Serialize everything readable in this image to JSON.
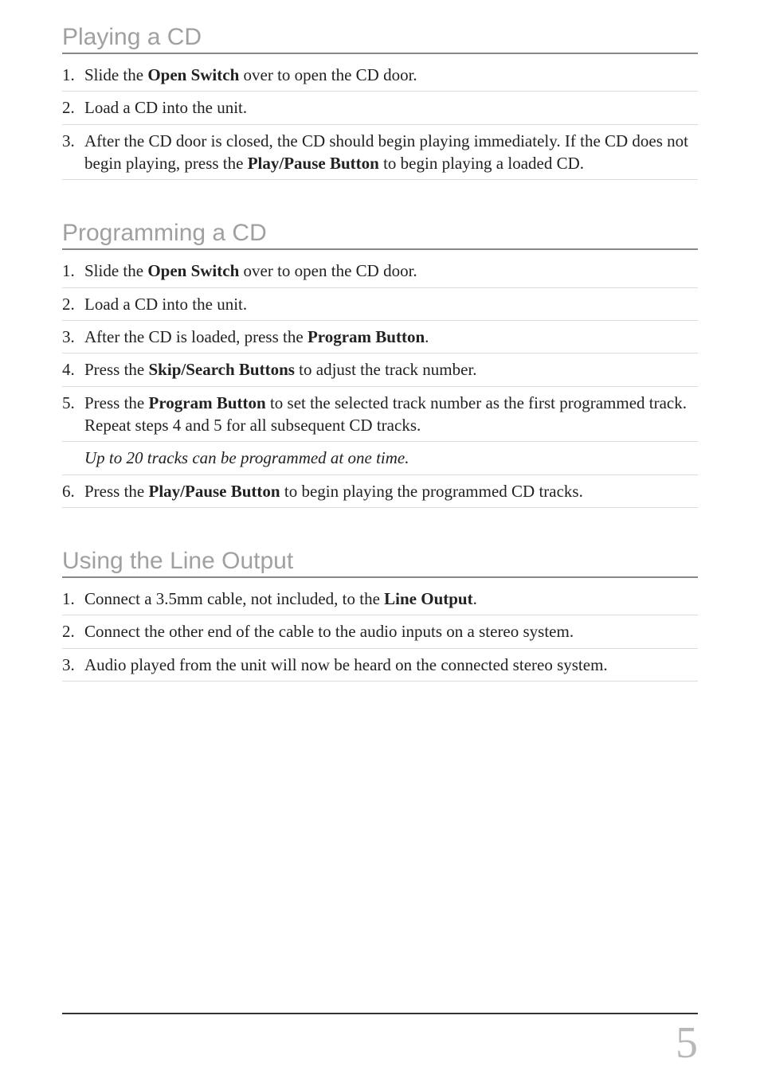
{
  "sections": [
    {
      "heading": "Playing a CD",
      "items": [
        {
          "type": "step",
          "runs": [
            {
              "t": "Slide the "
            },
            {
              "t": "Open Switch",
              "b": true
            },
            {
              "t": " over to open the CD door."
            }
          ]
        },
        {
          "type": "step",
          "runs": [
            {
              "t": "Load a CD into the unit."
            }
          ]
        },
        {
          "type": "step",
          "runs": [
            {
              "t": "After the CD door is closed, the CD should begin playing immediately.  If the CD does not begin playing, press the "
            },
            {
              "t": "Play/Pause Button",
              "b": true
            },
            {
              "t": " to begin playing a loaded CD."
            }
          ]
        }
      ]
    },
    {
      "heading": "Programming a CD",
      "items": [
        {
          "type": "step",
          "runs": [
            {
              "t": "Slide the "
            },
            {
              "t": "Open Switch",
              "b": true
            },
            {
              "t": " over to open the CD door."
            }
          ]
        },
        {
          "type": "step",
          "runs": [
            {
              "t": "Load a CD into the unit."
            }
          ]
        },
        {
          "type": "step",
          "runs": [
            {
              "t": "After the CD is loaded, press the "
            },
            {
              "t": "Program Button",
              "b": true
            },
            {
              "t": "."
            }
          ]
        },
        {
          "type": "step",
          "runs": [
            {
              "t": "Press the "
            },
            {
              "t": "Skip/Search Buttons",
              "b": true
            },
            {
              "t": " to adjust the track number."
            }
          ]
        },
        {
          "type": "step",
          "runs": [
            {
              "t": "Press the "
            },
            {
              "t": "Program Button",
              "b": true
            },
            {
              "t": " to set the selected track number as the first programmed track.  Repeat steps 4 and 5 for all subsequent CD tracks."
            }
          ]
        },
        {
          "type": "note",
          "runs": [
            {
              "t": "Up to 20 tracks can be programmed at one time."
            }
          ]
        },
        {
          "type": "step",
          "runs": [
            {
              "t": "Press the "
            },
            {
              "t": "Play/Pause Button",
              "b": true
            },
            {
              "t": " to begin playing the programmed CD tracks."
            }
          ]
        }
      ]
    },
    {
      "heading": "Using the Line Output",
      "items": [
        {
          "type": "step",
          "runs": [
            {
              "t": "Connect a 3.5mm cable, not included, to the "
            },
            {
              "t": "Line Output",
              "b": true
            },
            {
              "t": "."
            }
          ]
        },
        {
          "type": "step",
          "runs": [
            {
              "t": "Connect the other end of the cable to the audio inputs on a stereo system."
            }
          ]
        },
        {
          "type": "step",
          "runs": [
            {
              "t": "Audio played from the unit will now be heard on the connected stereo system."
            }
          ]
        }
      ]
    }
  ],
  "page_number": "5"
}
